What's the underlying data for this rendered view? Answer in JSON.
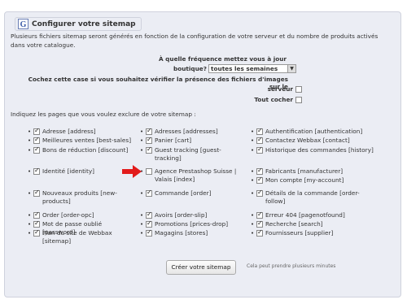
{
  "panel": {
    "title": "Configurer votre sitemap",
    "intro": "Plusieurs fichiers sitemap seront générés en fonction de la configuration de votre serveur et du nombre de produits activés dans votre catalogue.",
    "frequency_label_1": "À quelle fréquence mettez vous à jour votre",
    "frequency_label_2": "boutique?",
    "frequency_value": "toutes les semaines",
    "images_label_1": "Cochez cette case si vous souhaitez vérifier la présence des fichiers d'images sur le",
    "images_label_2": "serveur",
    "check_all_label": "Tout cocher",
    "exclude_label": "Indiquez les pages que vous voulez exclure de votre sitemap :",
    "submit_label": "Créer votre sitemap",
    "note": "Cela peut prendre plusieurs minutes"
  },
  "pages_col1": [
    {
      "label": "Adresse [address]",
      "checked": true
    },
    {
      "label": "Meilleures ventes [best-sales]",
      "checked": true
    },
    {
      "label": "Bons de réduction [discount]",
      "checked": true
    },
    {
      "label": "Identité [identity]",
      "checked": true
    },
    {
      "label": "Nouveaux produits [new-products]",
      "checked": true
    },
    {
      "label": "Order [order-opc]",
      "checked": true
    },
    {
      "label": "Mot de passe oublié [password]",
      "checked": true
    },
    {
      "label": "Plan du site de Webbax [sitemap]",
      "checked": true
    }
  ],
  "pages_col2": [
    {
      "label": "Adresses [addresses]",
      "checked": true
    },
    {
      "label": "Panier [cart]",
      "checked": true
    },
    {
      "label": "Guest tracking [guest-tracking]",
      "checked": true
    },
    {
      "label": "Agence Prestashop Suisse | Valais [index]",
      "checked": false
    },
    {
      "label": "Commande [order]",
      "checked": true
    },
    {
      "label": "Avoirs [order-slip]",
      "checked": true
    },
    {
      "label": "Promotions [prices-drop]",
      "checked": true
    },
    {
      "label": "Magagins [stores]",
      "checked": true
    }
  ],
  "pages_col3": [
    {
      "label": "Authentification [authentication]",
      "checked": true
    },
    {
      "label": "Contactez Webbax [contact]",
      "checked": true
    },
    {
      "label": "Historique des commandes [history]",
      "checked": true
    },
    {
      "label": "Fabricants [manufacturer]",
      "checked": true
    },
    {
      "label": "Mon compte [my-account]",
      "checked": true
    },
    {
      "label": "Détails de la commande [order-follow]",
      "checked": true
    },
    {
      "label": "Erreur 404 [pagenotfound]",
      "checked": true
    },
    {
      "label": "Recherche [search]",
      "checked": true
    },
    {
      "label": "Fournisseurs [supplier]",
      "checked": true
    }
  ],
  "colors": {
    "panel_bg": "#ebedf4",
    "arrow": "#e21b1b"
  }
}
